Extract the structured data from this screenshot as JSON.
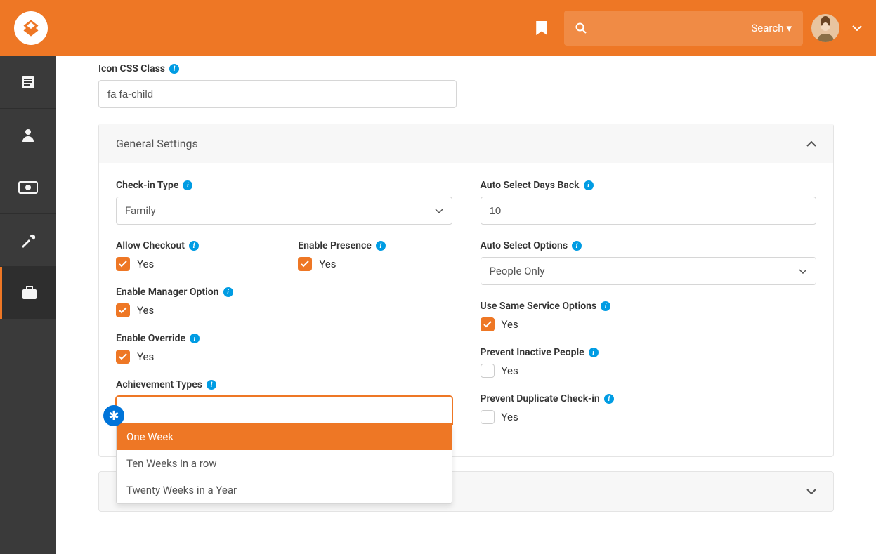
{
  "header": {
    "search_placeholder": "",
    "search_label": "Search"
  },
  "fields": {
    "icon_css_class": {
      "label": "Icon CSS Class",
      "value": "fa fa-child"
    }
  },
  "general_settings": {
    "title": "General Settings",
    "checkin_type": {
      "label": "Check-in Type",
      "value": "Family"
    },
    "allow_checkout": {
      "label": "Allow Checkout",
      "text": "Yes"
    },
    "enable_presence": {
      "label": "Enable Presence",
      "text": "Yes"
    },
    "enable_manager": {
      "label": "Enable Manager Option",
      "text": "Yes"
    },
    "enable_override": {
      "label": "Enable Override",
      "text": "Yes"
    },
    "achievement_types": {
      "label": "Achievement Types",
      "options": [
        "One Week",
        "Ten Weeks in a row",
        "Twenty Weeks in a Year"
      ]
    },
    "auto_select_days": {
      "label": "Auto Select Days Back",
      "value": "10"
    },
    "auto_select_options": {
      "label": "Auto Select Options",
      "value": "People Only"
    },
    "use_same_service": {
      "label": "Use Same Service Options",
      "text": "Yes"
    },
    "prevent_inactive": {
      "label": "Prevent Inactive People",
      "text": "Yes"
    },
    "prevent_duplicate": {
      "label": "Prevent Duplicate Check-in",
      "text": "Yes"
    }
  }
}
